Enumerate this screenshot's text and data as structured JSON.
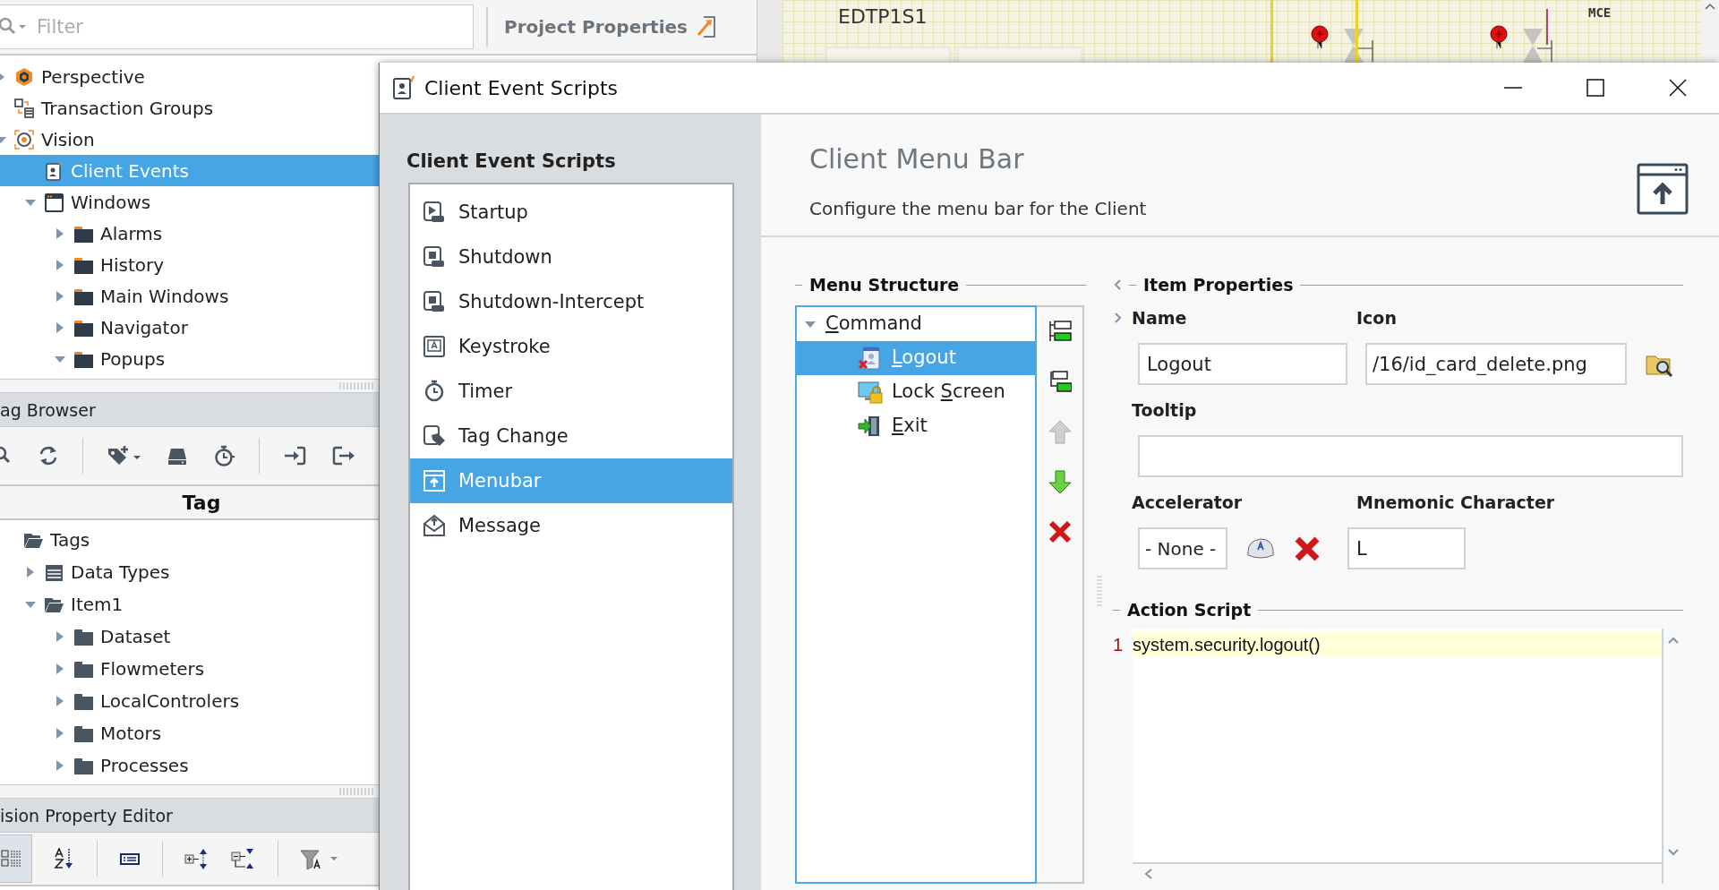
{
  "designer_canvas": {
    "labels": [
      {
        "text": "EDTP1S1"
      },
      {
        "text": "MCE"
      }
    ]
  },
  "project_browser": {
    "filter": {
      "placeholder": "Filter"
    },
    "properties_button": {
      "label": "Project Properties"
    },
    "tree": [
      {
        "label": "Perspective",
        "kind": "perspective",
        "expanded": false,
        "selected": false
      },
      {
        "label": "Transaction Groups",
        "kind": "transaction",
        "selected": false
      },
      {
        "label": "Vision",
        "kind": "vision",
        "expanded": true,
        "selected": false,
        "children": [
          {
            "label": "Client Events",
            "kind": "client-events",
            "selected": true
          },
          {
            "label": "Windows",
            "kind": "window",
            "expanded": true,
            "selected": false,
            "children": [
              {
                "label": "Alarms",
                "kind": "folder",
                "expanded": false,
                "selected": false
              },
              {
                "label": "History",
                "kind": "folder",
                "expanded": false,
                "selected": false
              },
              {
                "label": "Main Windows",
                "kind": "folder",
                "expanded": false,
                "selected": false
              },
              {
                "label": "Navigator",
                "kind": "folder",
                "expanded": false,
                "selected": false
              },
              {
                "label": "Popups",
                "kind": "folder",
                "expanded": true,
                "selected": false
              }
            ]
          }
        ]
      }
    ]
  },
  "tag_browser": {
    "title": "ag Browser",
    "column": "Tag",
    "tree": [
      {
        "label": "Tags",
        "kind": "open-folder",
        "selected": false,
        "children": [
          {
            "label": "Data Types",
            "kind": "data-types",
            "expanded": false,
            "selected": false
          },
          {
            "label": "Item1",
            "kind": "open-folder",
            "expanded": true,
            "selected": false,
            "children": [
              {
                "label": "Dataset",
                "kind": "tag-folder",
                "expanded": false,
                "selected": false
              },
              {
                "label": "Flowmeters",
                "kind": "tag-folder",
                "expanded": false,
                "selected": false
              },
              {
                "label": "LocalControlers",
                "kind": "tag-folder",
                "expanded": false,
                "selected": false
              },
              {
                "label": "Motors",
                "kind": "tag-folder",
                "expanded": false,
                "selected": false
              },
              {
                "label": "Processes",
                "kind": "tag-folder",
                "expanded": false,
                "selected": false
              }
            ]
          }
        ]
      }
    ]
  },
  "property_editor": {
    "title": "ision Property Editor"
  },
  "dialog": {
    "title": "Client Event Scripts",
    "sidebar": {
      "heading": "Client Event Scripts",
      "items": [
        {
          "label": "Startup",
          "kind": "startup",
          "selected": false
        },
        {
          "label": "Shutdown",
          "kind": "shutdown",
          "selected": false
        },
        {
          "label": "Shutdown-Intercept",
          "kind": "shutdown",
          "selected": false
        },
        {
          "label": "Keystroke",
          "kind": "keystroke",
          "selected": false
        },
        {
          "label": "Timer",
          "kind": "timer",
          "selected": false
        },
        {
          "label": "Tag Change",
          "kind": "tag-change",
          "selected": false
        },
        {
          "label": "Menubar",
          "kind": "menubar",
          "selected": true
        },
        {
          "label": "Message",
          "kind": "message",
          "selected": false
        }
      ]
    },
    "header": {
      "title": "Client Menu Bar",
      "subtitle": "Configure the menu bar for the Client"
    },
    "menu_structure": {
      "title": "Menu Structure",
      "tree": [
        {
          "mnemonic": "C",
          "label_after": "ommand",
          "expanded": true,
          "selected": false,
          "children": [
            {
              "mnemonic": "L",
              "label_after": "ogout",
              "kind": "logout",
              "selected": true
            },
            {
              "label_before": "Lock ",
              "mnemonic": "S",
              "label_after": "creen",
              "kind": "lock",
              "selected": false
            },
            {
              "mnemonic": "E",
              "label_after": "xit",
              "kind": "exit",
              "selected": false
            }
          ]
        }
      ],
      "buttons": [
        {
          "kind": "add-item",
          "disabled": false
        },
        {
          "kind": "add-child",
          "disabled": false
        },
        {
          "kind": "move-up",
          "disabled": true
        },
        {
          "kind": "move-down",
          "disabled": false
        },
        {
          "kind": "delete",
          "disabled": false
        }
      ]
    },
    "item_properties": {
      "title": "Item Properties",
      "name": {
        "label": "Name",
        "value": "Logout"
      },
      "icon": {
        "label": "Icon",
        "value": "/16/id_card_delete.png"
      },
      "tooltip": {
        "label": "Tooltip"
      },
      "accelerator": {
        "label": "Accelerator",
        "value": "- None -"
      },
      "mnemonic": {
        "label": "Mnemonic Character",
        "value": "L"
      }
    },
    "action_script": {
      "title": "Action Script",
      "lines": [
        {
          "number": "1",
          "code": "system.security.logout()",
          "current": true
        }
      ]
    }
  }
}
